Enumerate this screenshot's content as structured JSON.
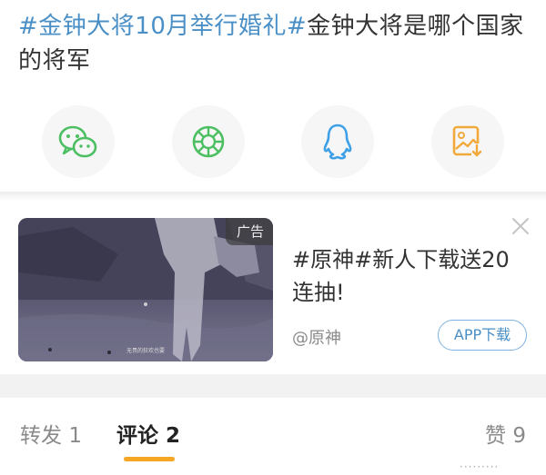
{
  "post": {
    "title_topic": "#金钟大将10月举行婚礼#",
    "title_rest": "金钟大将是哪个国家的将军"
  },
  "share": [
    {
      "icon": "wechat-icon",
      "color": "#4cbf63"
    },
    {
      "icon": "moments-icon",
      "color": "#4cbf63"
    },
    {
      "icon": "qq-icon",
      "color": "#3ea0e6"
    },
    {
      "icon": "save-image-icon",
      "color": "#f2a93b"
    }
  ],
  "ad": {
    "badge": "广告",
    "thumb_caption": "无畏的狂欢也要",
    "text": "#原神#新人下载送20连抽!",
    "source": "@原神",
    "button": "APP下载"
  },
  "tabs": [
    {
      "label": "转发",
      "count": "1"
    },
    {
      "label": "评论",
      "count": "2"
    },
    {
      "label": "赞",
      "count": "9"
    }
  ],
  "watermark": "·········"
}
